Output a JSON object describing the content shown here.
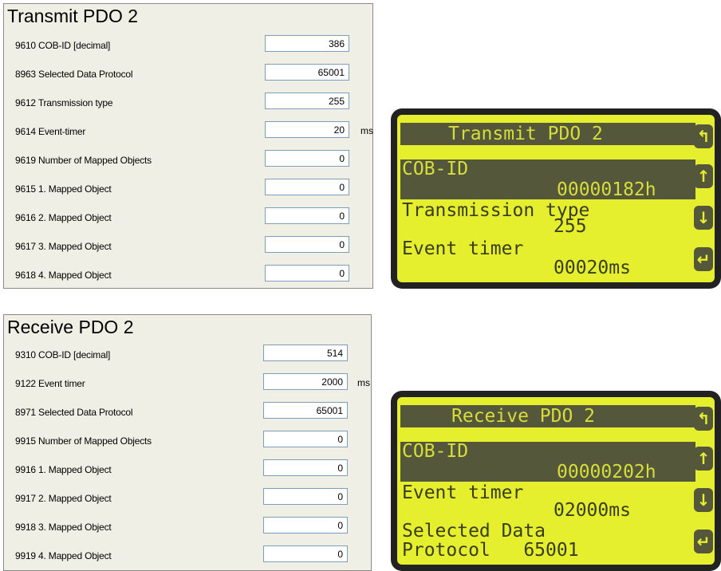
{
  "transmit": {
    "title": "Transmit PDO 2",
    "rows": [
      {
        "label": "9610 COB-ID [decimal]",
        "value": "386",
        "unit": ""
      },
      {
        "label": "8963 Selected Data Protocol",
        "value": "65001",
        "unit": ""
      },
      {
        "label": "9612 Transmission type",
        "value": "255",
        "unit": ""
      },
      {
        "label": "9614 Event-timer",
        "value": "20",
        "unit": "ms"
      },
      {
        "label": "9619 Number of Mapped Objects",
        "value": "0",
        "unit": ""
      },
      {
        "label": "9615 1. Mapped Object",
        "value": "0",
        "unit": ""
      },
      {
        "label": "9616 2. Mapped Object",
        "value": "0",
        "unit": ""
      },
      {
        "label": "9617 3. Mapped Object",
        "value": "0",
        "unit": ""
      },
      {
        "label": "9618 4. Mapped Object",
        "value": "0",
        "unit": ""
      }
    ]
  },
  "receive": {
    "title": "Receive PDO 2",
    "rows": [
      {
        "label": "9310 COB-ID [decimal]",
        "value": "514",
        "unit": ""
      },
      {
        "label": "9122 Event timer",
        "value": "2000",
        "unit": "ms"
      },
      {
        "label": "8971 Selected Data Protocol",
        "value": "65001",
        "unit": ""
      },
      {
        "label": "9915 Number of Mapped Objects",
        "value": "0",
        "unit": ""
      },
      {
        "label": "9916 1. Mapped Object",
        "value": "0",
        "unit": ""
      },
      {
        "label": "9917 2. Mapped Object",
        "value": "0",
        "unit": ""
      },
      {
        "label": "9918 3. Mapped Object",
        "value": "0",
        "unit": ""
      },
      {
        "label": "9919 4. Mapped Object",
        "value": "0",
        "unit": ""
      }
    ]
  },
  "lcd_transmit": {
    "header": "Transmit PDO 2",
    "sel_label": "COB-ID",
    "sel_value": "00000182h",
    "line1": "Transmission type",
    "line2": "255",
    "line3": "Event timer",
    "line4": "00020ms",
    "buttons": [
      "back-arrow-icon",
      "up-arrow-icon",
      "down-arrow-icon",
      "enter-icon"
    ]
  },
  "lcd_receive": {
    "header": "Receive PDO 2",
    "sel_label": "COB-ID",
    "sel_value": "00000202h",
    "line1": "Event timer",
    "line2": "02000ms",
    "line3": "Selected Data",
    "line4": "Protocol   65001",
    "buttons": [
      "back-arrow-icon",
      "up-arrow-icon",
      "down-arrow-icon",
      "enter-icon"
    ]
  },
  "colors": {
    "panel_bg": "#f0efe5",
    "lcd_bg": "#e6ef2e",
    "lcd_dark": "#55573a",
    "bezel": "#222222"
  }
}
